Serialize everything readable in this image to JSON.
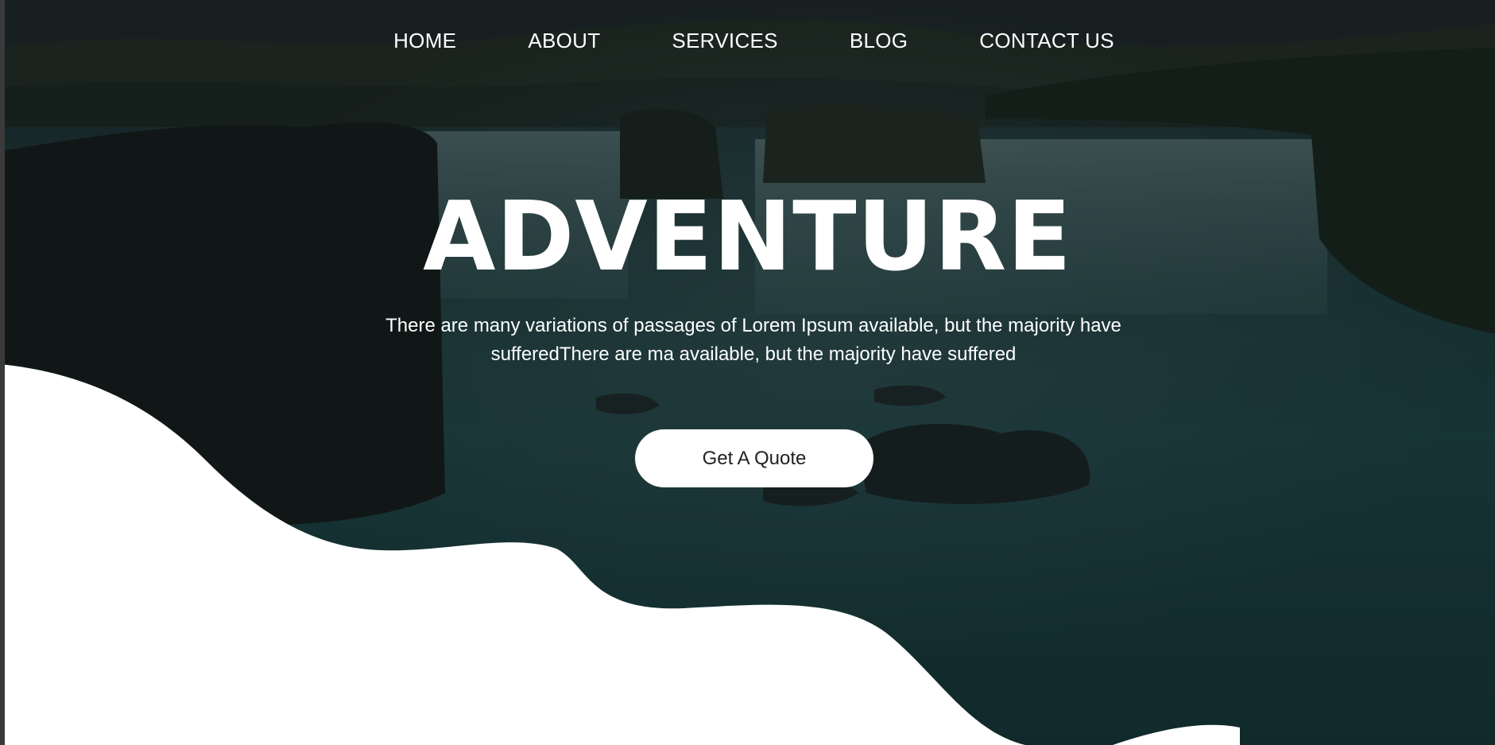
{
  "nav": {
    "items": [
      {
        "label": "HOME"
      },
      {
        "label": "ABOUT"
      },
      {
        "label": "SERVICES"
      },
      {
        "label": "BLOG"
      },
      {
        "label": "CONTACT US"
      }
    ]
  },
  "hero": {
    "title": "ADVENTURE",
    "text": "There are many variations of passages of Lorem Ipsum available, but the majority have sufferedThere are ma available, but the majority have suffered",
    "cta_label": "Get A Quote"
  },
  "colors": {
    "overlay": "#0f1c1e",
    "water": "#1d4a4c",
    "text": "#ffffff",
    "button_bg": "#ffffff",
    "button_text": "#222222"
  },
  "background": {
    "icon": "waterfall-landscape-photo"
  }
}
